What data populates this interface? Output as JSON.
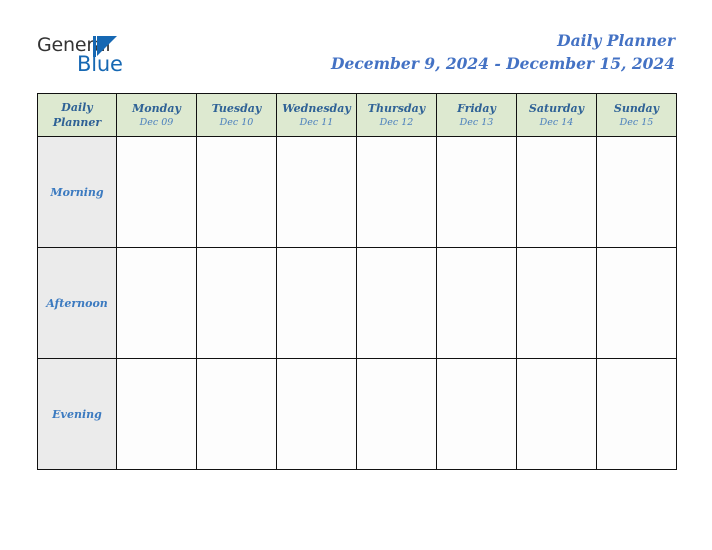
{
  "brand": {
    "name_part1": "General",
    "name_part2": "Blue",
    "mark": "blue-triangle-logo-mark",
    "colors": {
      "dark_text": "#333333",
      "blue": "#1668b3"
    }
  },
  "header": {
    "title": "Daily Planner",
    "date_range": "December 9, 2024 - December 15, 2024",
    "title_color": "#4472c4"
  },
  "table": {
    "corner_label_line1": "Daily",
    "corner_label_line2": "Planner",
    "header_bg": "#dde9d0",
    "row_label_bg": "#ebebeb",
    "cell_bg": "#fdfdfd",
    "border_color": "#111111",
    "day_name_color": "#2f6296",
    "day_date_color": "#4a7fbd",
    "row_label_color": "#3b7ac0",
    "columns": [
      {
        "day": "Monday",
        "date": "Dec 09"
      },
      {
        "day": "Tuesday",
        "date": "Dec 10"
      },
      {
        "day": "Wednesday",
        "date": "Dec 11"
      },
      {
        "day": "Thursday",
        "date": "Dec 12"
      },
      {
        "day": "Friday",
        "date": "Dec 13"
      },
      {
        "day": "Saturday",
        "date": "Dec 14"
      },
      {
        "day": "Sunday",
        "date": "Dec 15"
      }
    ],
    "rows": [
      {
        "label": "Morning",
        "cells": [
          "",
          "",
          "",
          "",
          "",
          "",
          ""
        ]
      },
      {
        "label": "Afternoon",
        "cells": [
          "",
          "",
          "",
          "",
          "",
          "",
          ""
        ]
      },
      {
        "label": "Evening",
        "cells": [
          "",
          "",
          "",
          "",
          "",
          "",
          ""
        ]
      }
    ]
  }
}
